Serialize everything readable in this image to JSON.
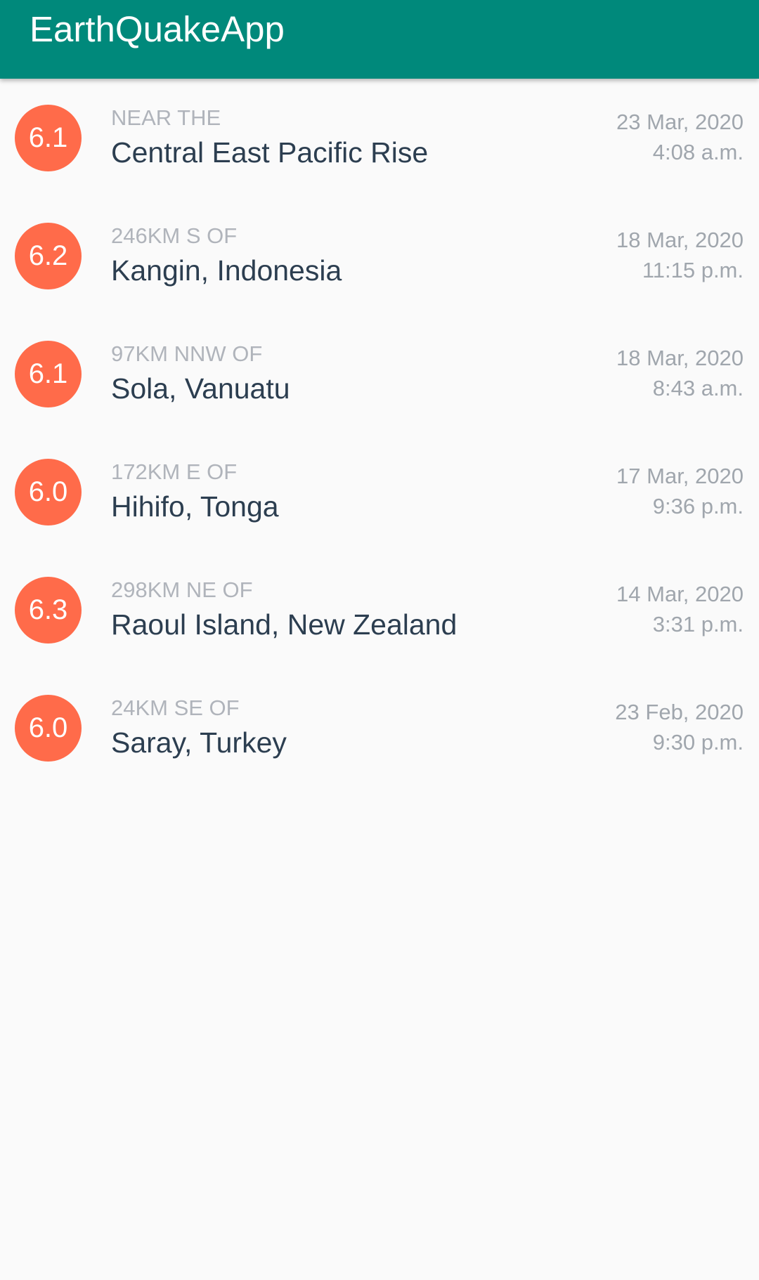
{
  "app_bar": {
    "title": "EarthQuakeApp",
    "background_color": "#00897b"
  },
  "magnitude_color": "#ff6b4a",
  "earthquakes": [
    {
      "magnitude": "6.1",
      "location_offset": "NEAR THE",
      "primary_location": "Central East Pacific Rise",
      "date": "23 Mar, 2020",
      "time": "4:08 a.m."
    },
    {
      "magnitude": "6.2",
      "location_offset": "246KM S OF",
      "primary_location": "Kangin, Indonesia",
      "date": "18 Mar, 2020",
      "time": "11:15 p.m."
    },
    {
      "magnitude": "6.1",
      "location_offset": "97KM NNW OF",
      "primary_location": "Sola, Vanuatu",
      "date": "18 Mar, 2020",
      "time": "8:43 a.m."
    },
    {
      "magnitude": "6.0",
      "location_offset": "172KM E OF",
      "primary_location": "Hihifo, Tonga",
      "date": "17 Mar, 2020",
      "time": "9:36 p.m."
    },
    {
      "magnitude": "6.3",
      "location_offset": "298KM NE OF",
      "primary_location": "Raoul Island, New Zealand",
      "date": "14 Mar, 2020",
      "time": "3:31 p.m."
    },
    {
      "magnitude": "6.0",
      "location_offset": "24KM SE OF",
      "primary_location": "Saray, Turkey",
      "date": "23 Feb, 2020",
      "time": "9:30 p.m."
    }
  ]
}
